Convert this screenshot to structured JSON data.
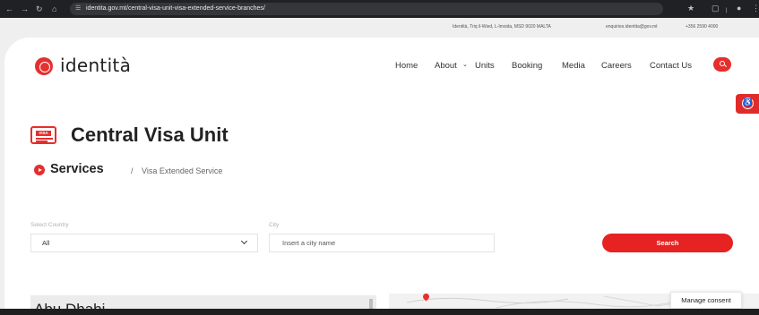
{
  "browser": {
    "url": "identita.gov.mt/central-visa-unit-visa-extended-service-branches/"
  },
  "contact": {
    "address": "Identità, Triq il-Wied, L-Imsida, MSD 9020 MALTA",
    "email": "enquiries.identita@gov.mt",
    "phone": "+356 2590 4000"
  },
  "header": {
    "logo_text": "identità",
    "nav": [
      {
        "label": "Home"
      },
      {
        "label": "About"
      },
      {
        "label": "Units"
      },
      {
        "label": "Booking"
      },
      {
        "label": "Media"
      },
      {
        "label": "Careers"
      },
      {
        "label": "Contact Us"
      }
    ],
    "about_chevron": "⌄"
  },
  "page": {
    "icon_label": "VISA",
    "title": "Central Visa Unit",
    "breadcrumb": {
      "section": "Services",
      "separator": "/",
      "current": "Visa Extended Service"
    }
  },
  "form": {
    "country_label": "Select Country",
    "country_value": "All",
    "city_label": "City",
    "city_placeholder": "Insert a city name",
    "search_label": "Search"
  },
  "results": {
    "heading_partial": "Abu Dhabi"
  },
  "consent": {
    "label": "Manage consent"
  },
  "colors": {
    "brand_red": "#e62e2e",
    "text_dark": "#222222",
    "page_bg": "#efefef"
  },
  "icons": {
    "back": "arrow-left-icon",
    "forward": "arrow-right-icon",
    "reload": "reload-icon",
    "home": "home-icon",
    "site_info": "site-info-icon",
    "bookmark": "star-icon",
    "search": "search-icon",
    "accessibility": "accessibility-icon"
  }
}
